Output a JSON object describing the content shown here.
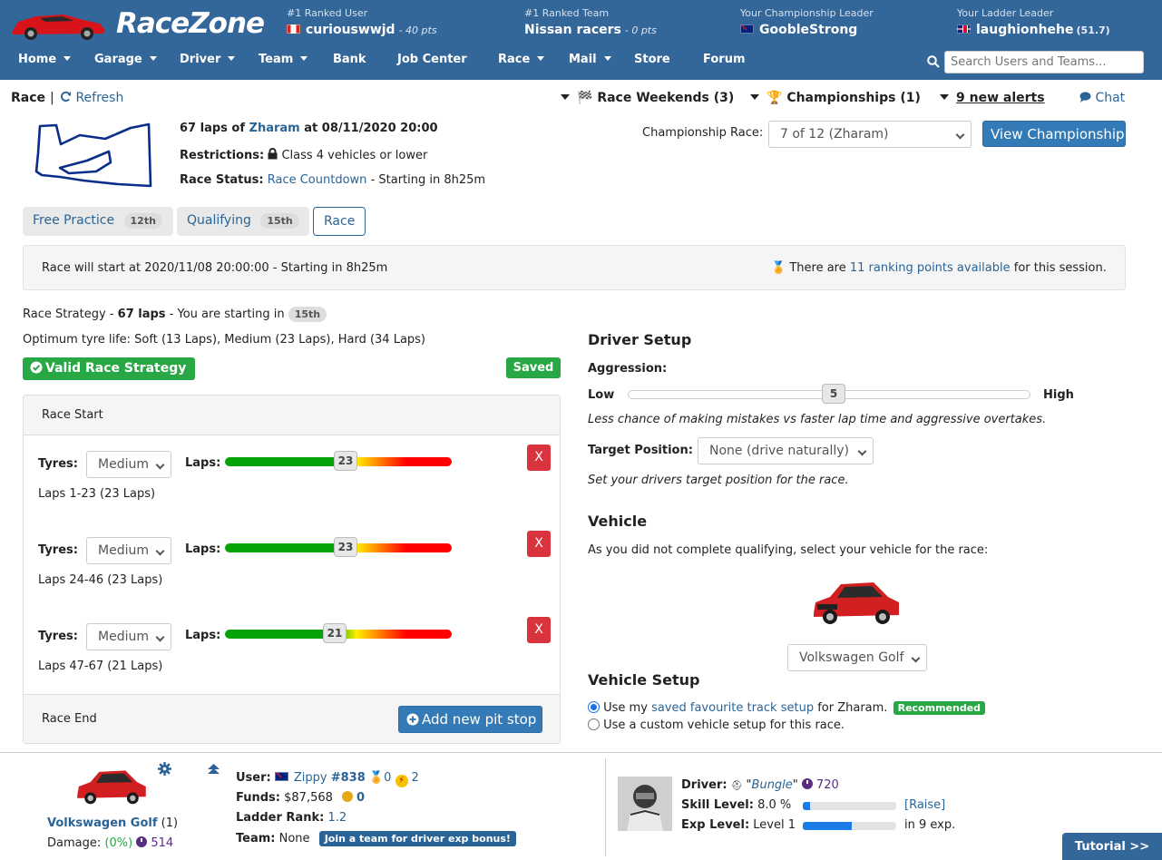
{
  "brand": "RaceZone",
  "header": {
    "ranked_user": {
      "label": "#1 Ranked User",
      "name": "curiouswwjd",
      "pts": "- 40 pts"
    },
    "ranked_team": {
      "label": "#1 Ranked Team",
      "name": "Nissan racers",
      "pts": "- 0 pts"
    },
    "champ_leader": {
      "label": "Your Championship Leader",
      "name": "GoobleStrong"
    },
    "ladder_leader": {
      "label": "Your Ladder Leader",
      "name": "laughionhehe",
      "value": "(51.7)"
    }
  },
  "nav": [
    "Home",
    "Garage",
    "Driver",
    "Team",
    "Bank",
    "Job Center",
    "Race",
    "Mail",
    "Store",
    "Forum"
  ],
  "search": {
    "placeholder": "Search Users and Teams..."
  },
  "topbar": {
    "race": "Race",
    "sep": "|",
    "refresh": "Refresh",
    "race_weekends": "Race Weekends (3)",
    "championships": "Championships (1)",
    "alerts": "9 new alerts",
    "chat": "Chat"
  },
  "race_info": {
    "laps_prefix": "67 laps of",
    "track": "Zharam",
    "at": "at 08/11/2020 20:00",
    "restrictions_label": "Restrictions:",
    "restrictions": "Class 4 vehicles or lower",
    "status_label": "Race Status:",
    "status_link": "Race Countdown",
    "status_rest": "- Starting in 8h25m"
  },
  "championship": {
    "label": "Championship Race:",
    "selected": "7 of 12 (Zharam)",
    "button": "View Championship"
  },
  "tabs": [
    {
      "label": "Free Practice",
      "badge": "12th"
    },
    {
      "label": "Qualifying",
      "badge": "15th"
    },
    {
      "label": "Race",
      "badge": ""
    }
  ],
  "infobar": {
    "start": "Race will start at 2020/11/08 20:00:00 - Starting in 8h25m",
    "ranking_pre": "There are",
    "ranking_link": "11 ranking points available",
    "ranking_post": "for this session."
  },
  "strategy": {
    "prefix": "Race Strategy -",
    "laps": "67 laps",
    "starting": "- You are starting in",
    "position": "15th",
    "tyre_life": "Optimum tyre life: Soft (13 Laps), Medium (23 Laps), Hard (34 Laps)",
    "valid": "Valid Race Strategy",
    "saved": "Saved",
    "race_start": "Race Start",
    "race_end": "Race End",
    "add_pit": "Add new pit stop",
    "tyres_label": "Tyres:",
    "laps_label": "Laps:",
    "remove": "X",
    "stints": [
      {
        "tyre": "Medium",
        "laps": "23",
        "range": "Laps 1-23 (23 Laps)"
      },
      {
        "tyre": "Medium",
        "laps": "23",
        "range": "Laps 24-46 (23 Laps)"
      },
      {
        "tyre": "Medium",
        "laps": "21",
        "range": "Laps 47-67 (21 Laps)"
      }
    ]
  },
  "driver_setup": {
    "title": "Driver Setup",
    "aggression_label": "Aggression:",
    "low": "Low",
    "high": "High",
    "aggression": "5",
    "aggression_desc": "Less chance of making mistakes vs faster lap time and aggressive overtakes.",
    "target_label": "Target Position:",
    "target": "None (drive naturally)",
    "target_desc": "Set your drivers target position for the race."
  },
  "vehicle": {
    "title": "Vehicle",
    "desc": "As you did not complete qualifying, select your vehicle for the race:",
    "selected": "Volkswagen Golf",
    "setup_title": "Vehicle Setup",
    "opt1_pre": "Use my",
    "opt1_link": "saved favourite track setup",
    "opt1_post": "for Zharam.",
    "recommended": "Recommended",
    "opt2": "Use a custom vehicle setup for this race."
  },
  "footer": {
    "car_name": "Volkswagen Golf",
    "car_count": "(1)",
    "damage_label": "Damage:",
    "damage": "(0%)",
    "damage_time": "514",
    "user_label": "User:",
    "user": "Zippy",
    "user_rank": "#838",
    "medals": "0",
    "bolts": "2",
    "funds_label": "Funds:",
    "funds": "$87,568",
    "coins": "0",
    "ladder_label": "Ladder Rank:",
    "ladder": "1.2",
    "team_label": "Team:",
    "team": "None",
    "team_btn": "Join a team for driver exp bonus!",
    "driver_label": "Driver:",
    "driver": "Bungle",
    "driver_time": "720",
    "skill_label": "Skill Level:",
    "skill": "8.0 %",
    "skill_fraction": 0.08,
    "raise": "[Raise]",
    "exp_label": "Exp Level:",
    "exp": "Level 1",
    "exp_fraction": 0.52,
    "exp_next": "in 9 exp.",
    "tutorial": "Tutorial >>"
  },
  "colors": {
    "header": "#336699",
    "link": "#2a6496",
    "green": "#28a745",
    "danger": "#d9343d",
    "primary": "#337ab7"
  }
}
